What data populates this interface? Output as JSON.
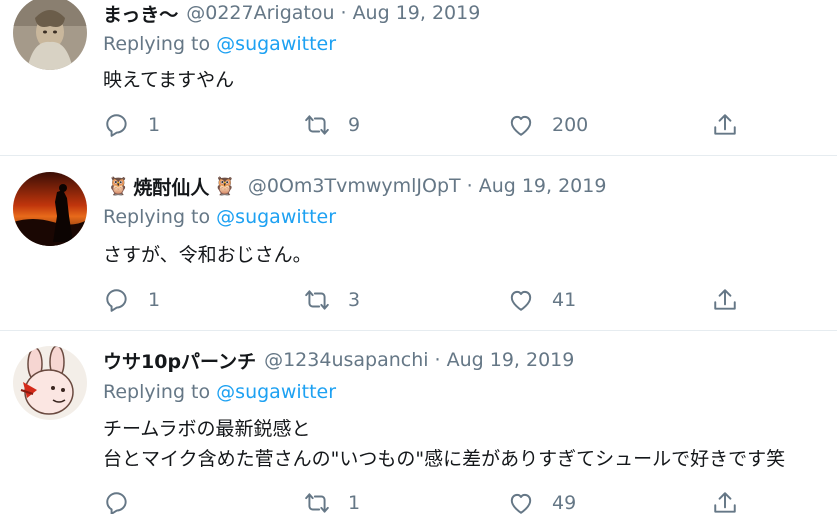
{
  "tweets": [
    {
      "display_name": "まっき～",
      "owls": false,
      "handle": "@0227Arigatou",
      "date": "Aug 19, 2019",
      "replying_prefix": "Replying to",
      "replying_to": "@sugawitter",
      "lines": [
        "映えてますやん"
      ],
      "reply_count": "1",
      "retweet_count": "9",
      "like_count": "200"
    },
    {
      "display_name": "焼酎仙人",
      "owls": true,
      "handle": "@0Om3TvmwymlJOpT",
      "date": "Aug 19, 2019",
      "replying_prefix": "Replying to",
      "replying_to": "@sugawitter",
      "lines": [
        "さすが、令和おじさん。"
      ],
      "reply_count": "1",
      "retweet_count": "3",
      "like_count": "41"
    },
    {
      "display_name": "ウサ10pパーンチ",
      "owls": false,
      "handle": "@1234usapanchi",
      "date": "Aug 19, 2019",
      "replying_prefix": "Replying to",
      "replying_to": "@sugawitter",
      "lines": [
        "チームラボの最新鋭感と",
        "台とマイク含めた菅さんの\"いつもの\"感に差がありすぎてシュールで好きです笑"
      ],
      "reply_count": "",
      "retweet_count": "1",
      "like_count": "49"
    }
  ],
  "separator": "·",
  "colors": {
    "text": "#14171a",
    "secondary": "#657786",
    "link": "#1da1f2",
    "divider": "#e6ecf0"
  },
  "icons": [
    "reply-icon",
    "retweet-icon",
    "like-icon",
    "share-icon",
    "owl-icon"
  ]
}
